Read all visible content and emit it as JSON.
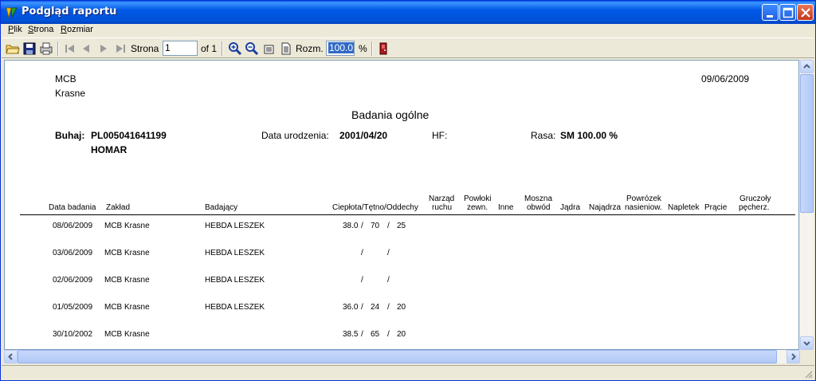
{
  "window": {
    "title": "Podgląd raportu"
  },
  "menu": [
    {
      "label": "Plik",
      "accel": "P"
    },
    {
      "label": "Strona",
      "accel": "S"
    },
    {
      "label": "Rozmiar",
      "accel": "R"
    }
  ],
  "toolbar": {
    "page_label": "Strona",
    "page_value": "1",
    "of_label": "of 1",
    "size_label": "Rozm.",
    "zoom_value": "100.0",
    "zoom_unit": "%"
  },
  "report": {
    "org_line1": "MCB",
    "org_line2": "Krasne",
    "date": "09/06/2009",
    "title": "Badania ogólne",
    "bull_label": "Buhaj:",
    "bull_id": "PL005041641199",
    "bull_name": "HOMAR",
    "birth_label": "Data urodzenia:",
    "birth_value": "2001/04/20",
    "hf_label": "HF:",
    "breed_label": "Rasa:",
    "breed_value": "SM 100.00 %",
    "columns": {
      "date": "Data badania",
      "plant": "Zakład",
      "examiner": "Badający",
      "vitals": "Ciepłota/Tętno/Oddechy",
      "locomotion_1": "Narząd",
      "locomotion_2": "ruchu",
      "coat_1": "Powłoki",
      "coat_2": "zewn.",
      "other": "Inne",
      "scrotum_1": "Moszna",
      "scrotum_2": "obwód",
      "testes": "Jądra",
      "epididymis": "Najądrza",
      "cord_1": "Powrózek",
      "cord_2": "nasieniow.",
      "prepuce": "Napletek",
      "penis": "Prącie",
      "glands_1": "Gruczoły",
      "glands_2": "pęcherz."
    },
    "rows": [
      {
        "date": "08/06/2009",
        "plant": "MCB Krasne",
        "examiner": "HEBDA  LESZEK",
        "temp": "38.0",
        "pulse": "70",
        "resp": "25"
      },
      {
        "date": "03/06/2009",
        "plant": "MCB Krasne",
        "examiner": "HEBDA  LESZEK",
        "temp": "",
        "pulse": "",
        "resp": ""
      },
      {
        "date": "02/06/2009",
        "plant": "MCB Krasne",
        "examiner": "HEBDA  LESZEK",
        "temp": "",
        "pulse": "",
        "resp": ""
      },
      {
        "date": "01/05/2009",
        "plant": "MCB Krasne",
        "examiner": "HEBDA  LESZEK",
        "temp": "36.0",
        "pulse": "24",
        "resp": "20"
      },
      {
        "date": "30/10/2002",
        "plant": "MCB Krasne",
        "examiner": "",
        "temp": "38.5",
        "pulse": "65",
        "resp": "20"
      }
    ]
  },
  "colors": {
    "titlebar": "#0058e6",
    "chrome": "#ece9d8",
    "selection": "#316ac5"
  }
}
